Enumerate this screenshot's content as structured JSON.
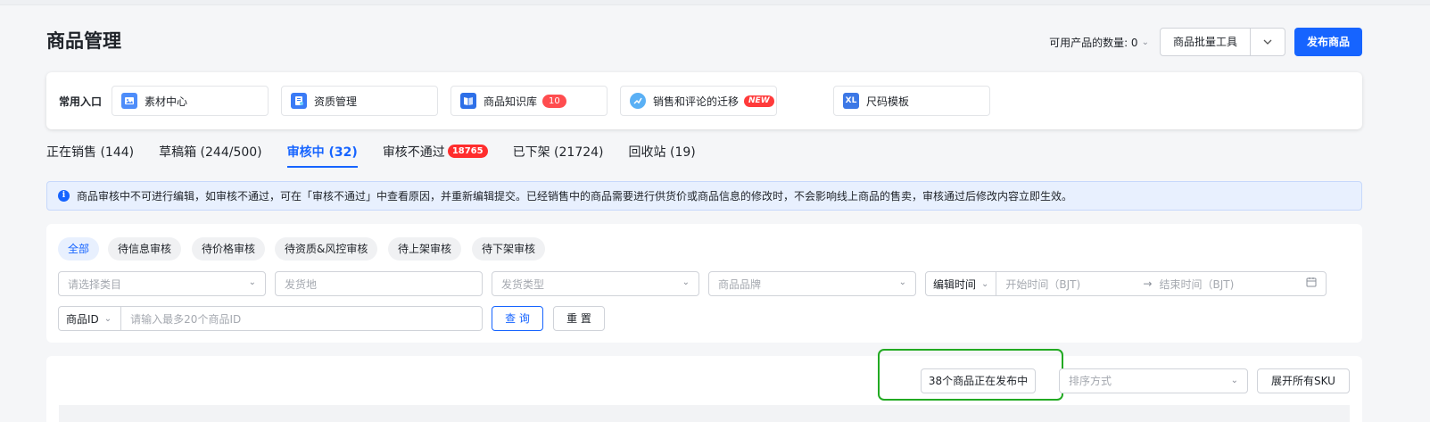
{
  "page": {
    "title": "商品管理",
    "available_count_label": "可用产品的数量: 0",
    "batch_tool_label": "商品批量工具",
    "publish_button_label": "发布商品"
  },
  "quick_entries": {
    "label": "常用入口",
    "items": [
      {
        "label": "素材中心",
        "icon": "material-center-icon"
      },
      {
        "label": "资质管理",
        "icon": "qualification-icon"
      },
      {
        "label": "商品知识库",
        "icon": "knowledge-book-icon",
        "badge": "10"
      },
      {
        "label": "销售和评论的迁移",
        "icon": "migration-icon",
        "badge": "NEW"
      },
      {
        "label": "尺码模板",
        "icon": "size-template-icon",
        "icon_text": "XL"
      }
    ]
  },
  "tabs": [
    {
      "label": "正在销售 (144)"
    },
    {
      "label": "草稿箱 (244/500)"
    },
    {
      "label": "审核中 (32)",
      "active": true
    },
    {
      "label": "审核不通过",
      "badge": "18765"
    },
    {
      "label": "已下架 (21724)"
    },
    {
      "label": "回收站 (19)"
    }
  ],
  "notice": {
    "icon": "info-icon",
    "text": "商品审核中不可进行编辑，如审核不通过，可在「审核不通过」中查看原因，并重新编辑提交。已经销售中的商品需要进行供货价或商品信息的修改时，不会影响线上商品的售卖，审核通过后修改内容立即生效。"
  },
  "status_filters": [
    "全部",
    "待信息审核",
    "待价格审核",
    "待资质&风控审核",
    "待上架审核",
    "待下架审核"
  ],
  "filters": {
    "category_placeholder": "请选择类目",
    "ship_from_placeholder": "发货地",
    "ship_type_placeholder": "发货类型",
    "brand_placeholder": "商品品牌",
    "time_type": "编辑时间",
    "start_time_placeholder": "开始时间（BJT)",
    "range_arrow": "→",
    "end_time_placeholder": "结束时间（BJT)",
    "id_type": "商品ID",
    "id_placeholder": "请输入最多20个商品ID",
    "query_label": "查 询",
    "reset_label": "重 置"
  },
  "list": {
    "publishing_label": "38个商品正在发布中",
    "sort_placeholder": "排序方式",
    "expand_sku_label": "展开所有SKU"
  },
  "colors": {
    "accent": "#1664ff",
    "badge_red": "#ff4d4f",
    "highlight_green": "#22aa22"
  }
}
